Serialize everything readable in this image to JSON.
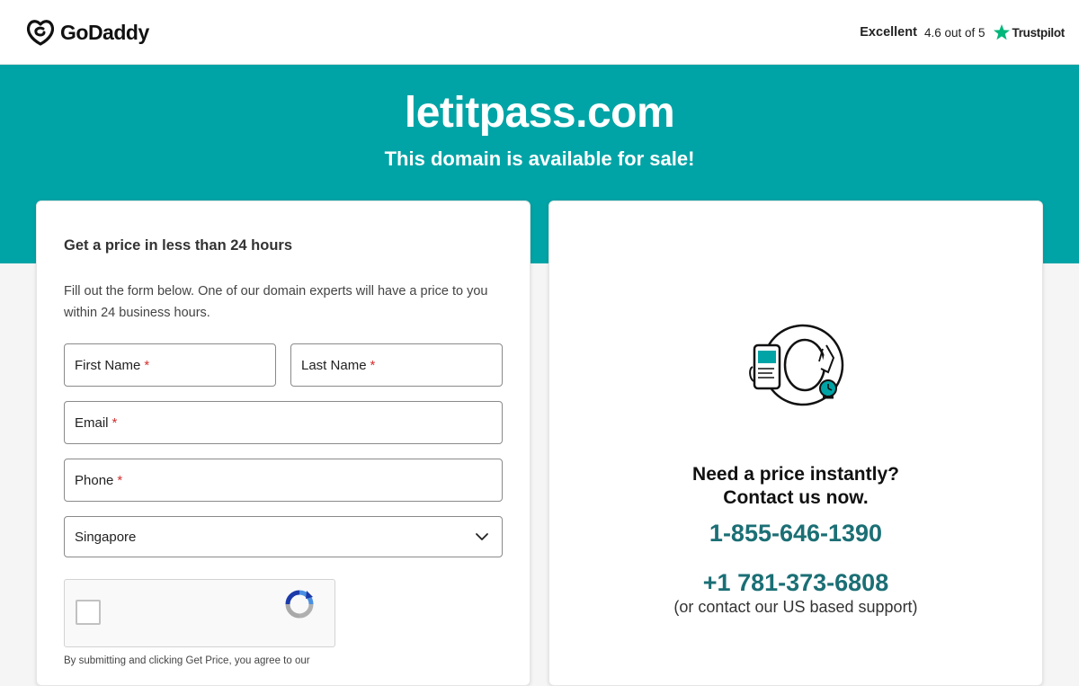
{
  "header": {
    "brand": "GoDaddy",
    "trustpilot": {
      "rating_word": "Excellent",
      "score_text": "4.6 out of 5",
      "provider": "Trustpilot"
    }
  },
  "hero": {
    "domain": "letitpass.com",
    "subtitle": "This domain is available for sale!"
  },
  "form": {
    "title": "Get a price in less than 24 hours",
    "description": "Fill out the form below. One of our domain experts will have a price to you within 24 business hours.",
    "first_name_label": "First Name",
    "last_name_label": "Last Name",
    "email_label": "Email",
    "phone_label": "Phone",
    "required_mark": "*",
    "country_selected": "Singapore",
    "terms_text": "By submitting and clicking Get Price, you agree to our"
  },
  "contact": {
    "heading_line1": "Need a price instantly?",
    "heading_line2": "Contact us now.",
    "phone_primary": "1-855-646-1390",
    "phone_secondary": "+1 781-373-6808",
    "support_note": "(or contact our US based support)"
  },
  "colors": {
    "hero_bg": "#00a4a6",
    "phone_text": "#1b6f75",
    "trustpilot_star": "#00b67a",
    "required": "#d32f2f"
  },
  "icons": [
    "godaddy-logo-icon",
    "trustpilot-star-icon",
    "chevron-down-icon",
    "recaptcha-icon",
    "phone-clock-illustration"
  ]
}
